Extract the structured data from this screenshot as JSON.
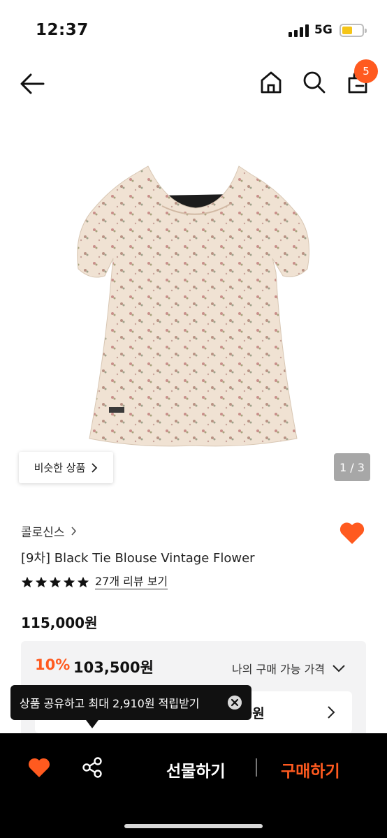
{
  "status_bar": {
    "time": "12:37",
    "network": "5G"
  },
  "nav": {
    "cart_count": "5"
  },
  "product": {
    "similar_label": "비슷한 상품",
    "page_indicator": "1 / 3",
    "brand": "콜로신스",
    "title": "[9차] Black Tie Blouse Vintage Flower",
    "rating_stars": 5,
    "reviews_link": "27개 리뷰 보기",
    "original_price": "115,000원",
    "discount": "10%",
    "sale_price": "103,500원",
    "my_price_label": "나의 구매 가능 가격",
    "coupon_amount": "0원"
  },
  "tooltip": {
    "text": "상품 공유하고 최대 2,910원 적립받기"
  },
  "bottom_bar": {
    "gift_label": "선물하기",
    "buy_label": "구매하기"
  },
  "colors": {
    "accent": "#ff5a1f",
    "bar": "#000000",
    "price_box": "#f3f3f4"
  }
}
